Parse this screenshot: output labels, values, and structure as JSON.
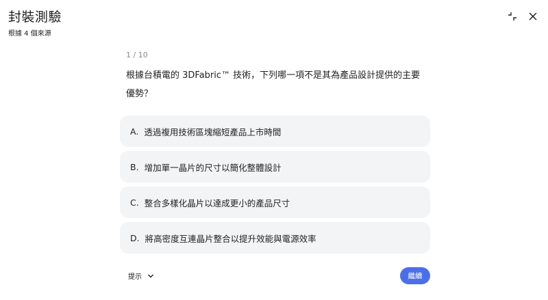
{
  "header": {
    "title": "封裝測驗",
    "subtitle": "根據 4 個來源",
    "icons": {
      "collapse": "collapse-icon",
      "close": "close-icon"
    }
  },
  "quiz": {
    "counter": "1 / 10",
    "question": "根據台積電的 3DFabric™ 技術，下列哪一項不是其為產品設計提供的主要優勢？",
    "options": [
      {
        "letter": "A.",
        "text": "透過複用技術區塊縮短產品上市時間"
      },
      {
        "letter": "B.",
        "text": "增加單一晶片的尺寸以簡化整體設計"
      },
      {
        "letter": "C.",
        "text": "整合多樣化晶片以達成更小的產品尺寸"
      },
      {
        "letter": "D.",
        "text": "將高密度互連晶片整合以提升效能與電源效率"
      }
    ]
  },
  "footer": {
    "hint_label": "提示",
    "hint_icon": "chevron-down-icon",
    "continue_label": "繼續"
  },
  "colors": {
    "accent": "#4c6fe8",
    "option_bg": "#f3f4f6",
    "muted_text": "#8a8a8a"
  }
}
